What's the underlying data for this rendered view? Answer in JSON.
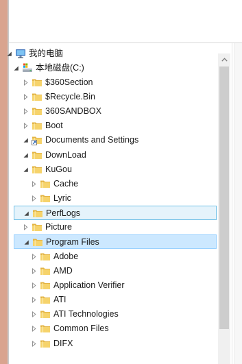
{
  "tree": {
    "root": {
      "label": "我的电脑",
      "state": "expanded",
      "icon": "computer-icon"
    },
    "drive": {
      "label": "本地磁盘(C:)",
      "state": "expanded",
      "icon": "drive-icon"
    },
    "items": [
      {
        "label": "$360Section",
        "state": "collapsed",
        "icon": "folder-icon"
      },
      {
        "label": "$Recycle.Bin",
        "state": "collapsed",
        "icon": "folder-icon"
      },
      {
        "label": "360SANDBOX",
        "state": "collapsed",
        "icon": "folder-icon"
      },
      {
        "label": "Boot",
        "state": "collapsed",
        "icon": "folder-icon"
      },
      {
        "label": "Documents and Settings",
        "state": "expanded",
        "icon": "shortcut-folder-icon"
      },
      {
        "label": "DownLoad",
        "state": "expanded",
        "icon": "folder-icon"
      },
      {
        "label": "KuGou",
        "state": "expanded",
        "icon": "folder-icon"
      },
      {
        "label": "Cache",
        "state": "collapsed",
        "icon": "folder-icon",
        "child": true
      },
      {
        "label": "Lyric",
        "state": "collapsed",
        "icon": "folder-icon",
        "child": true
      },
      {
        "label": "PerfLogs",
        "state": "expanded",
        "icon": "folder-icon",
        "status": "hover"
      },
      {
        "label": "Picture",
        "state": "collapsed",
        "icon": "folder-icon"
      },
      {
        "label": "Program Files",
        "state": "expanded",
        "icon": "folder-icon",
        "status": "selected"
      },
      {
        "label": "Adobe",
        "state": "collapsed",
        "icon": "folder-icon",
        "child": true
      },
      {
        "label": "AMD",
        "state": "collapsed",
        "icon": "folder-icon",
        "child": true
      },
      {
        "label": "Application Verifier",
        "state": "collapsed",
        "icon": "folder-icon",
        "child": true
      },
      {
        "label": "ATI",
        "state": "collapsed",
        "icon": "folder-icon",
        "child": true
      },
      {
        "label": "ATI Technologies",
        "state": "collapsed",
        "icon": "folder-icon",
        "child": true
      },
      {
        "label": "Common Files",
        "state": "collapsed",
        "icon": "folder-icon",
        "child": true
      },
      {
        "label": "DIFX",
        "state": "collapsed",
        "icon": "folder-icon",
        "child": true
      }
    ]
  },
  "colors": {
    "folder": "#f6d36b",
    "hover_bg": "#e5f3fb",
    "selected_bg": "#cce8ff",
    "scroll_thumb": "#cdcdcd"
  }
}
